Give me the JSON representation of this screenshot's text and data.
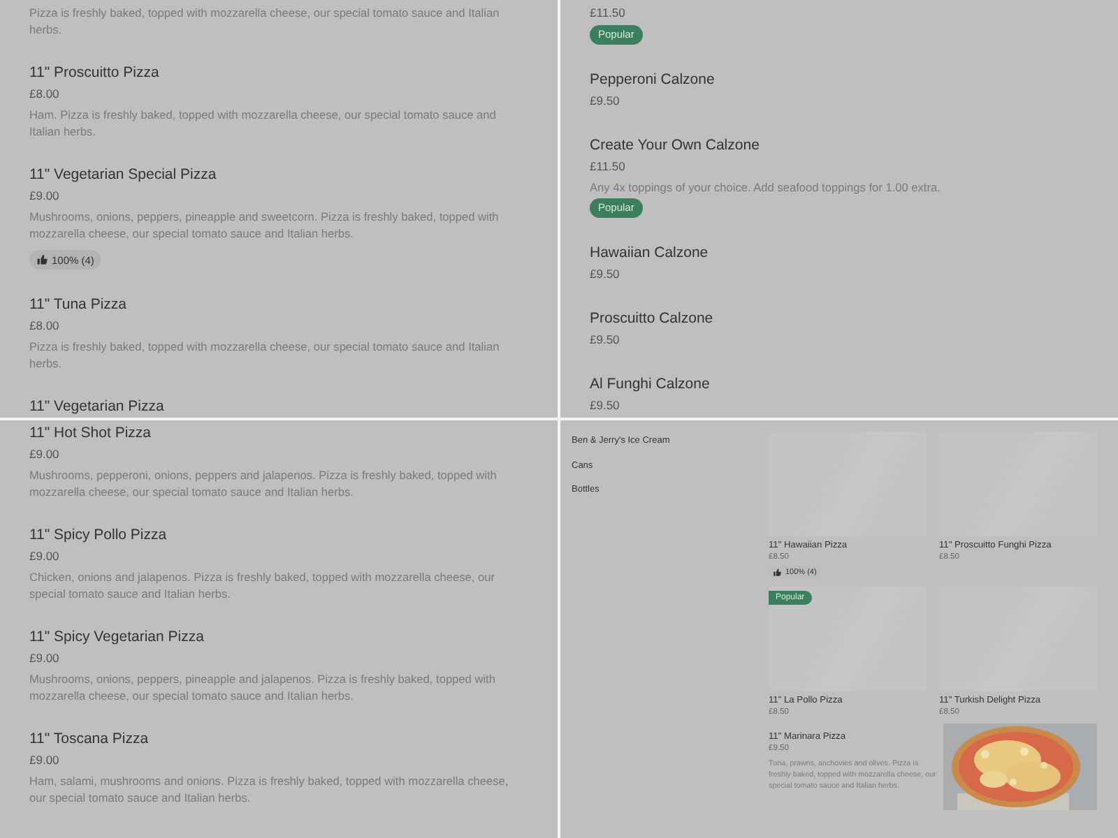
{
  "panels": [
    {
      "kind": "list",
      "items": [
        {
          "description": "Pizza is freshly baked, topped with mozzarella cheese, our special tomato sauce and Italian herbs."
        },
        {
          "name": "11\" Proscuitto Pizza",
          "price": "£8.00",
          "description": "Ham. Pizza is freshly baked, topped with mozzarella cheese, our special tomato sauce and Italian herbs."
        },
        {
          "name": "11\" Vegetarian Special Pizza",
          "price": "£9.00",
          "description": "Mushrooms, onions, peppers, pineapple and sweetcorn. Pizza is freshly baked, topped with mozzarella cheese, our special tomato sauce and Italian herbs.",
          "rating": "100% (4)"
        },
        {
          "name": "11\" Tuna Pizza",
          "price": "£8.00",
          "description": "Pizza is freshly baked, topped with mozzarella cheese, our special tomato sauce and Italian herbs."
        },
        {
          "name": "11\" Vegetarian Pizza"
        }
      ]
    },
    {
      "kind": "list",
      "items": [
        {
          "price": "£11.50",
          "badge": "Popular"
        },
        {
          "name": "Pepperoni Calzone",
          "price": "£9.50"
        },
        {
          "name": "Create Your Own Calzone",
          "price": "£11.50",
          "description": "Any 4x toppings of your choice. Add seafood toppings for 1.00 extra.",
          "badge": "Popular"
        },
        {
          "name": "Hawaiian Calzone",
          "price": "£9.50"
        },
        {
          "name": "Proscuitto Calzone",
          "price": "£9.50"
        },
        {
          "name": "Al Funghi Calzone",
          "price": "£9.50"
        }
      ]
    },
    {
      "kind": "list",
      "items": [
        {
          "name": "11\" Hot Shot Pizza",
          "price": "£9.00",
          "description": "Mushrooms, pepperoni, onions, peppers and jalapenos. Pizza is freshly baked, topped with mozzarella cheese, our special tomato sauce and Italian herbs."
        },
        {
          "name": "11\" Spicy Pollo Pizza",
          "price": "£9.00",
          "description": "Chicken, onions and jalapenos. Pizza is freshly baked, topped with mozzarella cheese, our special tomato sauce and Italian herbs."
        },
        {
          "name": "11\" Spicy Vegetarian Pizza",
          "price": "£9.00",
          "description": "Mushrooms, onions, peppers, pineapple and jalapenos. Pizza is freshly baked, topped with mozzarella cheese, our special tomato sauce and Italian herbs."
        },
        {
          "name": "11\" Toscana Pizza",
          "price": "£9.00",
          "description": "Ham, salami, mushrooms and onions. Pizza is freshly baked, topped with mozzarella cheese, our special tomato sauce and Italian herbs."
        }
      ]
    },
    {
      "kind": "grid",
      "categories": [
        "Ben & Jerry's Ice Cream",
        "Cans",
        "Bottles"
      ],
      "cards": [
        {
          "kind": "tile",
          "name": "11\" Hawaiian Pizza",
          "price": "£8.50",
          "rating": "100% (4)"
        },
        {
          "kind": "tile",
          "name": "11\" Proscuitto Funghi Pizza",
          "price": "£8.50"
        },
        {
          "kind": "tile",
          "badge": "Popular",
          "name": "11\" La Pollo Pizza",
          "price": "£8.50"
        },
        {
          "kind": "tile",
          "name": "11\" Turkish Delight Pizza",
          "price": "£8.50"
        },
        {
          "kind": "row",
          "name": "11\" Marinara Pizza",
          "price": "£9.50",
          "description": "Tuna, prawns, anchovies and olives. Pizza is freshly baked, topped with mozzarella cheese, our special tomato sauce and Italian herbs."
        }
      ]
    }
  ]
}
